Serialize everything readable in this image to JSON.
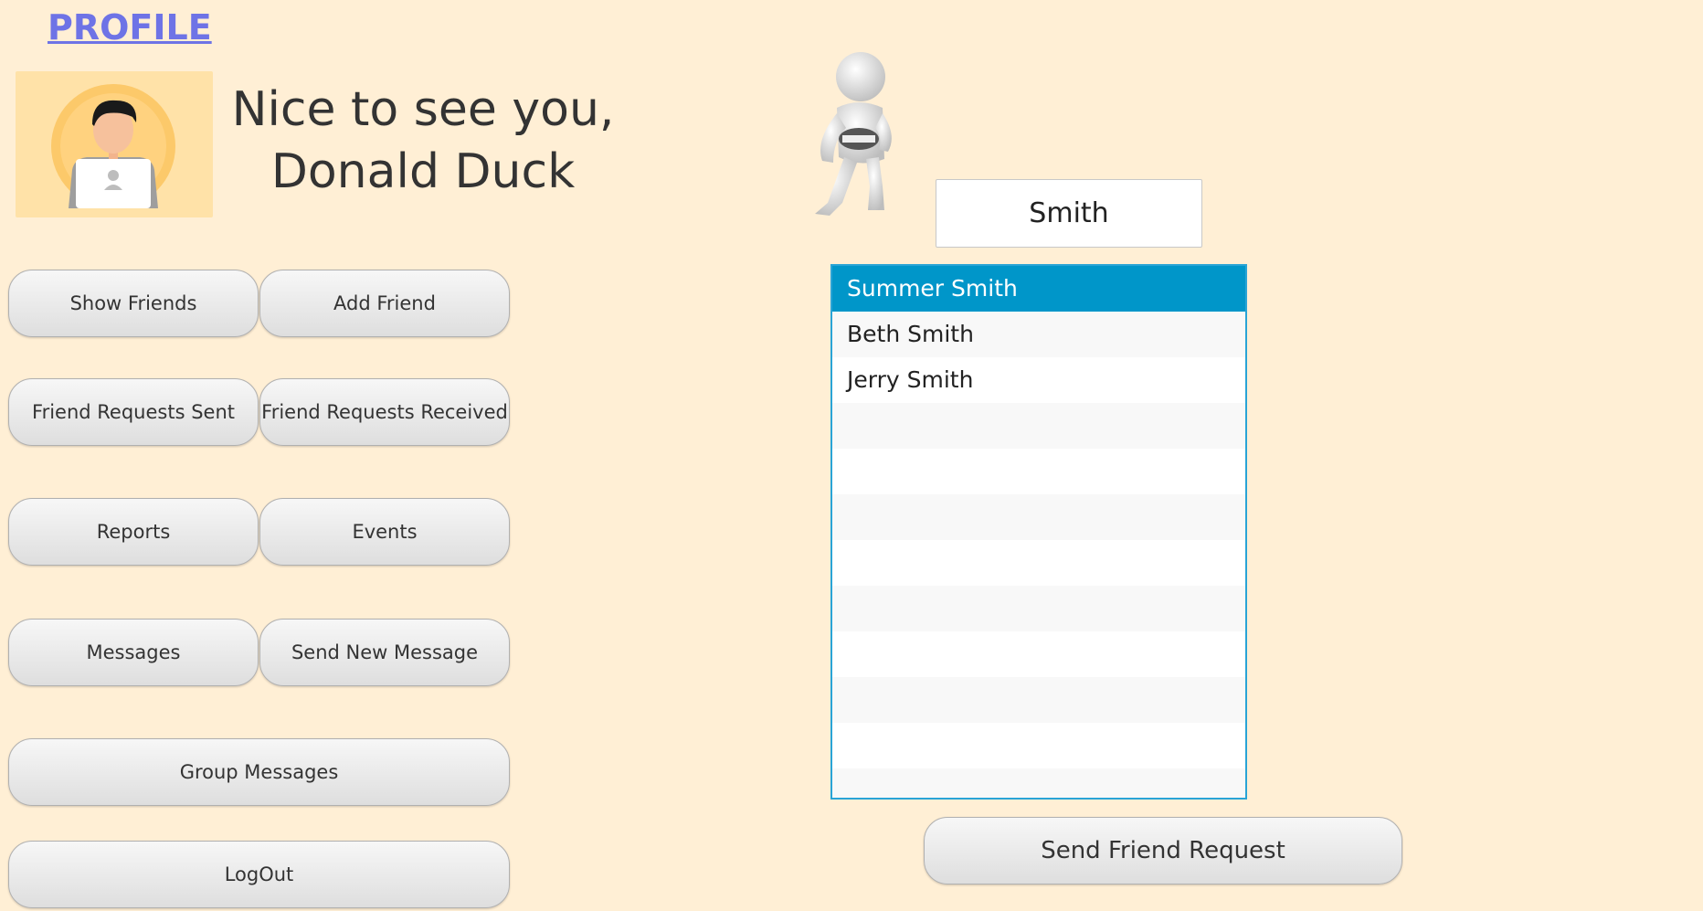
{
  "header": {
    "profile_link": "PROFILE",
    "greeting_line1": "Nice to see you,",
    "greeting_line2": "Donald Duck"
  },
  "menu": {
    "show_friends": "Show Friends",
    "add_friend": "Add Friend",
    "friend_requests_sent": "Friend Requests Sent",
    "friend_requests_received": "Friend Requests Received",
    "reports": "Reports",
    "events": "Events",
    "messages": "Messages",
    "send_new_message": "Send New Message",
    "group_messages": "Group Messages",
    "logout": "LogOut"
  },
  "search": {
    "value": "Smith"
  },
  "results": {
    "items": [
      "Summer Smith",
      "Beth Smith",
      "Jerry Smith"
    ],
    "selected_index": 0
  },
  "actions": {
    "send_friend_request": "Send Friend Request"
  },
  "colors": {
    "background": "#ffefd5",
    "selection": "#0096c9",
    "link": "#6e73e6"
  }
}
